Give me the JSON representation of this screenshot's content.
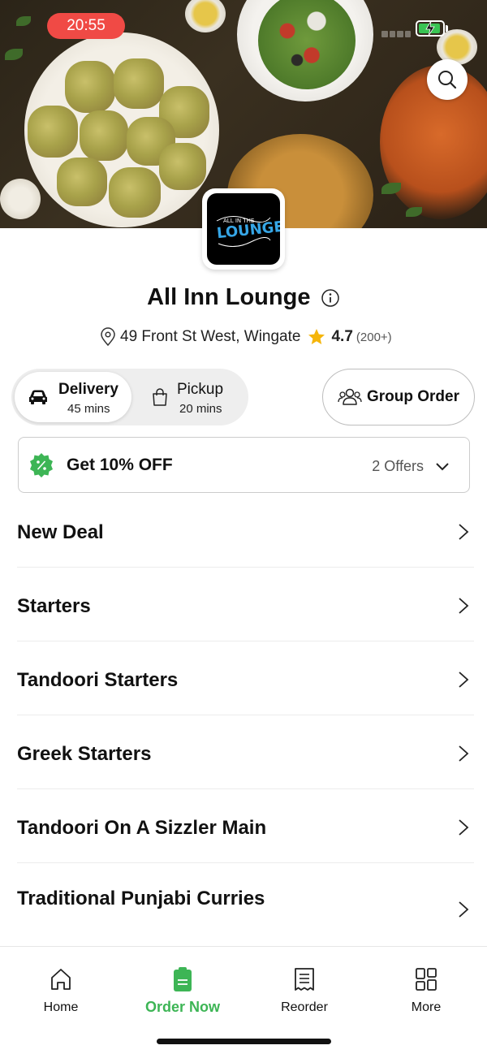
{
  "status_bar": {
    "time": "20:55"
  },
  "restaurant": {
    "name": "All Inn Lounge",
    "address": "49 Front St West, Wingate",
    "rating": "4.7",
    "rating_count": "(200+)",
    "logo_text": "LOUNGE",
    "logo_small_text": "ALL IN THE"
  },
  "modes": {
    "delivery": {
      "label": "Delivery",
      "time": "45 mins",
      "selected": true
    },
    "pickup": {
      "label": "Pickup",
      "time": "20 mins",
      "selected": false
    }
  },
  "group_order": {
    "label": "Group Order"
  },
  "offer": {
    "title": "Get 10% OFF",
    "count": "2 Offers"
  },
  "menu_categories": [
    {
      "label": "New Deal"
    },
    {
      "label": "Starters"
    },
    {
      "label": "Tandoori Starters"
    },
    {
      "label": "Greek Starters"
    },
    {
      "label": "Tandoori On A Sizzler Main"
    },
    {
      "label": "Traditional Punjabi Curries"
    }
  ],
  "bottom_nav": [
    {
      "label": "Home",
      "icon": "home-icon",
      "active": false
    },
    {
      "label": "Order Now",
      "icon": "order-icon",
      "active": true
    },
    {
      "label": "Reorder",
      "icon": "receipt-icon",
      "active": false
    },
    {
      "label": "More",
      "icon": "grid-icon",
      "active": false
    }
  ],
  "colors": {
    "accent_green": "#3db555",
    "time_pill_red": "#f04a45",
    "star_yellow": "#f5b50a",
    "logo_blue": "#36a6e6"
  }
}
